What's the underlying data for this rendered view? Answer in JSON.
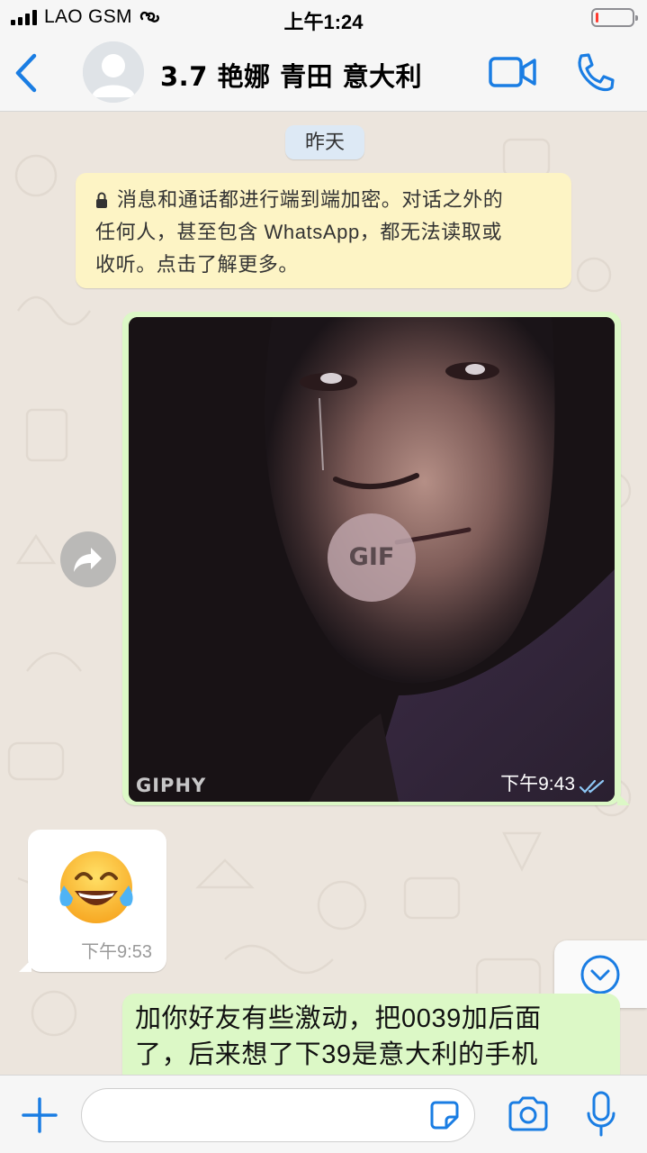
{
  "status_bar": {
    "carrier": "LAO GSM",
    "time": "上午1:24",
    "battery_level": 0.08,
    "battery_color": "#ff3b30"
  },
  "header": {
    "back_icon": "chevron-left-icon",
    "contact_name": "3.7 艳娜 青田  意大利",
    "accent_color": "#1a7de3"
  },
  "chat": {
    "date_chip": "昨天",
    "encryption_notice": {
      "line1": "消息和通话都进行端到端加密。对话之外的",
      "line2": "任何人，甚至包含 WhatsApp，都无法读取或",
      "line3": "收听。点击了解更多。"
    },
    "messages": [
      {
        "type": "gif",
        "direction": "outgoing",
        "overlay_label": "GIF",
        "source_label": "GIPHY",
        "time": "下午9:43",
        "status": "read"
      },
      {
        "type": "emoji",
        "direction": "incoming",
        "emoji": "😂",
        "time": "下午9:53"
      },
      {
        "type": "text",
        "direction": "outgoing",
        "line1": "加你好友有些激动，把0039加后面",
        "line2": "了，后来想了下39是意大利的手机"
      }
    ],
    "bubble_colors": {
      "outgoing": "#dcf8c6",
      "incoming": "#ffffff",
      "notice": "#fdf4c5",
      "date_chip": "#dde9f5"
    }
  },
  "input_bar": {
    "message_value": "",
    "placeholder": ""
  }
}
